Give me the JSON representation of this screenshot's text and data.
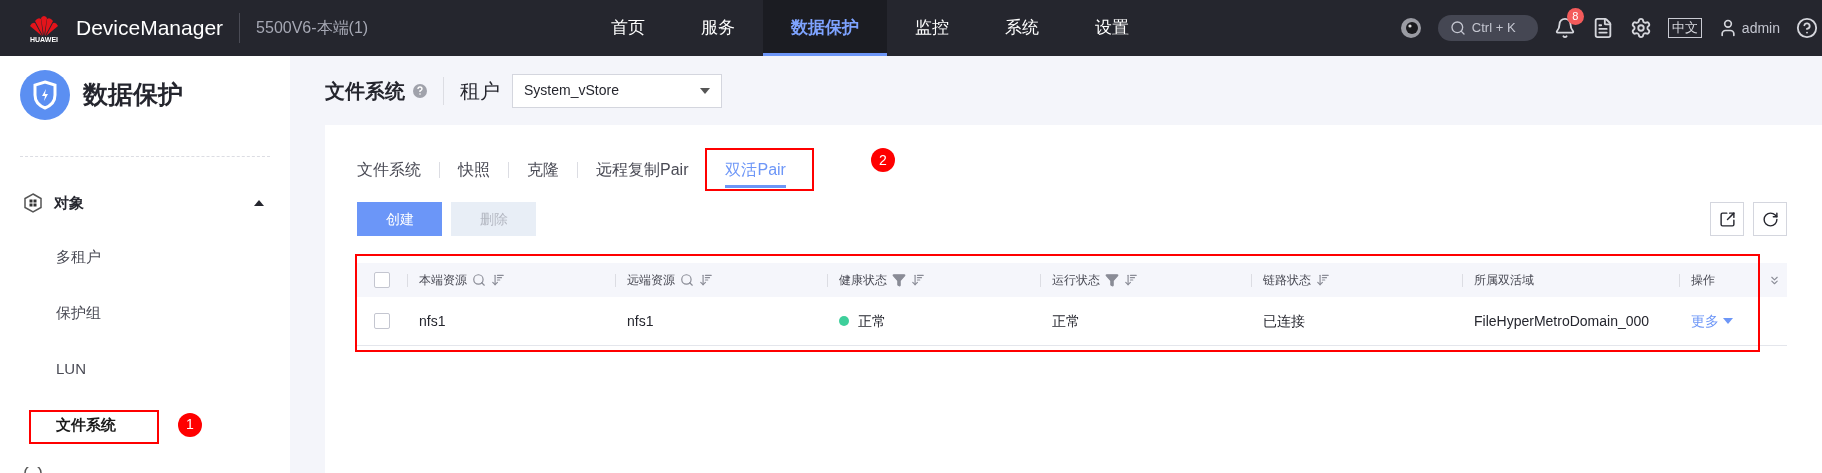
{
  "topbar": {
    "logo_text": "HUAWEI",
    "brand": "DeviceManager",
    "device": "5500V6-本端(1)",
    "nav": [
      {
        "label": "首页",
        "selected": false
      },
      {
        "label": "服务",
        "selected": false
      },
      {
        "label": "数据保护",
        "selected": true
      },
      {
        "label": "监控",
        "selected": false
      },
      {
        "label": "系统",
        "selected": false
      },
      {
        "label": "设置",
        "selected": false
      }
    ],
    "search_shortcut": "Ctrl + K",
    "notification_count": "8",
    "language": "中文",
    "user": "admin"
  },
  "sidebar": {
    "title": "数据保护",
    "groups": [
      {
        "label": "对象",
        "expanded": true,
        "children": [
          {
            "label": "多租户",
            "selected": false
          },
          {
            "label": "保护组",
            "selected": false
          },
          {
            "label": "LUN",
            "selected": false
          },
          {
            "label": "文件系统",
            "selected": true
          }
        ]
      }
    ]
  },
  "page": {
    "title": "文件系统",
    "tenant_label": "租户",
    "tenant": "System_vStore"
  },
  "tabs": [
    {
      "label": "文件系统",
      "selected": false
    },
    {
      "label": "快照",
      "selected": false
    },
    {
      "label": "克隆",
      "selected": false
    },
    {
      "label": "远程复制Pair",
      "selected": false
    },
    {
      "label": "双活Pair",
      "selected": true
    }
  ],
  "buttons": [
    {
      "label": "创建",
      "disabled": false
    },
    {
      "label": "删除",
      "disabled": true
    }
  ],
  "table": {
    "all_selected": false,
    "columns": [
      {
        "label": "本端资源",
        "tools": [
          {
            "kind": "search"
          },
          {
            "kind": "sort"
          }
        ]
      },
      {
        "label": "远端资源",
        "tools": [
          {
            "kind": "search"
          },
          {
            "kind": "sort"
          }
        ]
      },
      {
        "label": "健康状态",
        "tools": [
          {
            "kind": "filter"
          },
          {
            "kind": "sort"
          }
        ]
      },
      {
        "label": "运行状态",
        "tools": [
          {
            "kind": "filter"
          },
          {
            "kind": "sort"
          }
        ]
      },
      {
        "label": "链路状态",
        "tools": [
          {
            "kind": "sort"
          }
        ]
      },
      {
        "label": "所属双活域"
      },
      {
        "label": "操作"
      }
    ],
    "rows": [
      {
        "selected": false,
        "local": "nfs1",
        "remote": "nfs1",
        "health": "正常",
        "color": "#3ecf9b",
        "running": "正常",
        "link": "已连接",
        "domain": "FileHyperMetroDomain_000",
        "action": "更多"
      }
    ]
  },
  "annotations": [
    {
      "label": "1"
    },
    {
      "label": "2"
    }
  ]
}
